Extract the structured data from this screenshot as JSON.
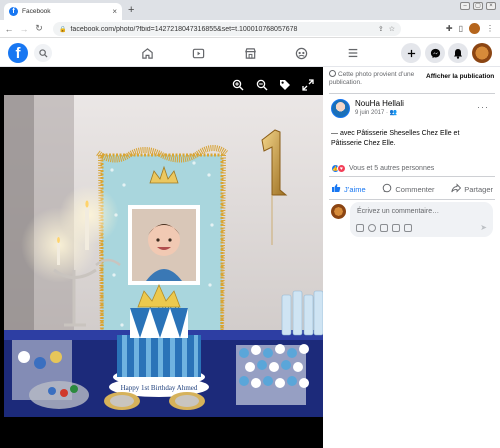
{
  "browser": {
    "tab_title": "Facebook",
    "tab_close": "×",
    "new_tab": "+",
    "url": "facebook.com/photo/?fbid=1427218047316855&set=t.100010768057678",
    "win_buttons": [
      "–",
      "▢",
      "×"
    ]
  },
  "fb_nav": {
    "logo": "f",
    "icons": [
      "search-icon",
      "home-icon",
      "watch-icon",
      "marketplace-icon",
      "groups-icon",
      "menu-icon",
      "create-icon",
      "messenger-icon",
      "notifications-icon",
      "account-icon"
    ]
  },
  "panel": {
    "notice": "Cette photo provient d’une publication.",
    "show_post": "Afficher la publication",
    "author": "NouHa Hellali",
    "date": "9 juin 2017 · ",
    "caption": "— avec Pâtisserie Sheselles Chez Elle et Pâtisserie Chez Elle.",
    "reactions_text": "Vous et 5 autres personnes",
    "actions": {
      "like": "J’aime",
      "comment": "Commenter",
      "share": "Partager"
    },
    "comment_placeholder": "Écrivez un commentaire…"
  },
  "photo": {
    "frame_text": "L   rince\n  un",
    "cake_text": "Happy 1st Birthday Ahmed",
    "balloon": "1"
  },
  "colors": {
    "fb_blue": "#1877f2",
    "gray_text": "#65676b",
    "viewer_bg": "#000000"
  }
}
